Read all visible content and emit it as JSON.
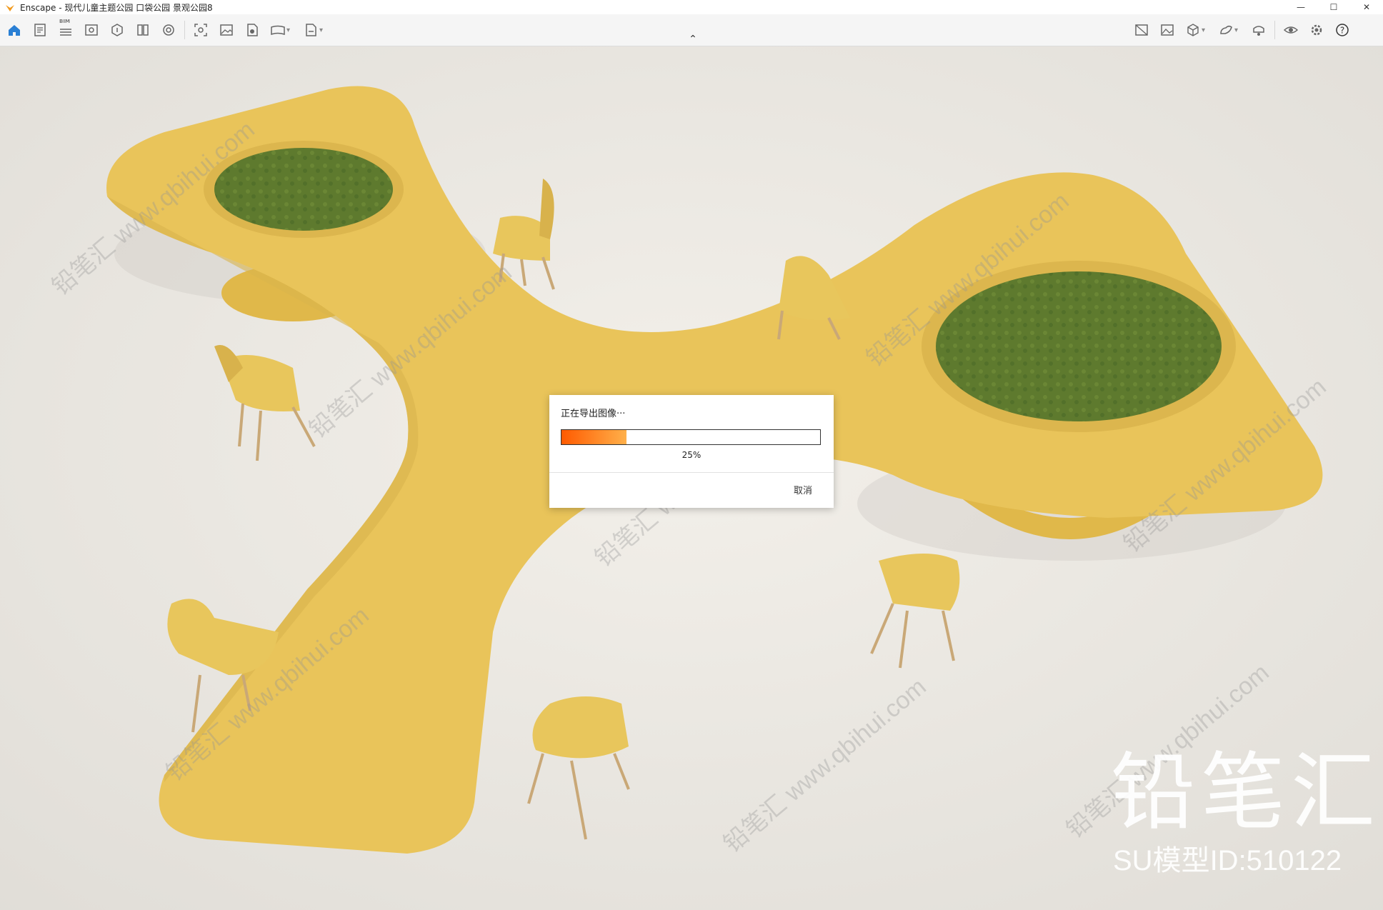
{
  "window": {
    "title": "Enscape - 现代儿童主题公园 口袋公园 景观公园8",
    "controls": {
      "minimize": "—",
      "maximize": "☐",
      "close": "✕"
    }
  },
  "toolbar": {
    "left_icons": [
      "home-icon",
      "notes-icon",
      "bim-icon",
      "views-icon",
      "assets-icon",
      "materials-icon",
      "atmosphere-icon",
      "capture-icon",
      "screenshot-icon",
      "batch-render-icon",
      "panorama-icon",
      "export-icon"
    ],
    "bim_label": "BIM",
    "right_icons": [
      "vr-icon",
      "image-icon",
      "cube-icon",
      "upload-icon",
      "safe-frame-icon",
      "eye-icon",
      "settings-icon",
      "help-icon"
    ],
    "accent_color": "#2a7fd4"
  },
  "dialog": {
    "title": "正在导出图像···",
    "progress_percent": 25,
    "progress_label": "25%",
    "cancel_label": "取消",
    "progress_colors": [
      "#ff5a00",
      "#ffb04a"
    ]
  },
  "watermark": {
    "brand": "铅笔汇",
    "model_id": "SU模型ID:510122",
    "tile_text": "铅笔汇 www.qbihui.com"
  },
  "scene": {
    "floor_color": "#ebe8e2",
    "table_color": "#e9c45a",
    "planter_color": "#5e7a2e",
    "chair_color": "#e8c65c"
  }
}
